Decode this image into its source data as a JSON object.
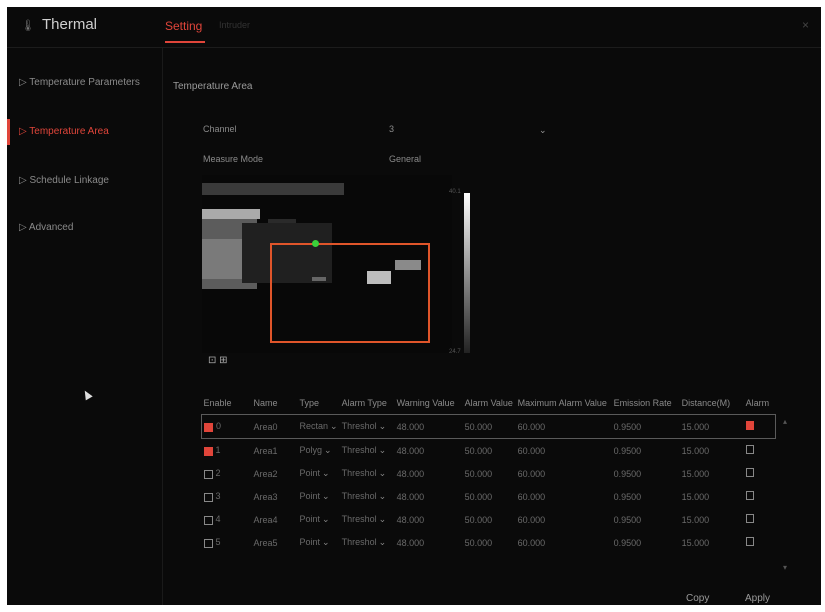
{
  "app": {
    "title": "Thermal",
    "close_icon": "×"
  },
  "tabs": {
    "setting": "Setting",
    "second": "Intruder"
  },
  "sidebar": {
    "items": [
      {
        "label": "▷ Temperature Parameters"
      },
      {
        "label": "▷ Temperature Area"
      },
      {
        "label": "▷ Schedule Linkage"
      },
      {
        "label": "▷ Advanced"
      }
    ]
  },
  "section": {
    "title": "Temperature Area"
  },
  "form": {
    "channel_label": "Channel",
    "channel_value": "3",
    "measure_mode_label": "Measure Mode",
    "measure_mode_value": "General"
  },
  "preview": {
    "icons": "⊡ ⊞",
    "scale_top": "40.1",
    "scale_bottom": "24.7"
  },
  "table": {
    "headers": [
      "Enable",
      "Name",
      "Type",
      "Alarm Type",
      "Warning Value",
      "Alarm Value",
      "Maximum Alarm Value",
      "Emission Rate",
      "Distance(M)",
      "Alarm"
    ],
    "rows": [
      {
        "id": "0",
        "name": "Area0",
        "type": "Rectan",
        "alarm_type": "Threshol",
        "warning": "48.000",
        "alarm": "50.000",
        "max": "60.000",
        "emission": "0.9500",
        "distance": "15.000"
      },
      {
        "id": "1",
        "name": "Area1",
        "type": "Polyg",
        "alarm_type": "Threshol",
        "warning": "48.000",
        "alarm": "50.000",
        "max": "60.000",
        "emission": "0.9500",
        "distance": "15.000"
      },
      {
        "id": "2",
        "name": "Area2",
        "type": "Point",
        "alarm_type": "Threshol",
        "warning": "48.000",
        "alarm": "50.000",
        "max": "60.000",
        "emission": "0.9500",
        "distance": "15.000"
      },
      {
        "id": "3",
        "name": "Area3",
        "type": "Point",
        "alarm_type": "Threshol",
        "warning": "48.000",
        "alarm": "50.000",
        "max": "60.000",
        "emission": "0.9500",
        "distance": "15.000"
      },
      {
        "id": "4",
        "name": "Area4",
        "type": "Point",
        "alarm_type": "Threshol",
        "warning": "48.000",
        "alarm": "50.000",
        "max": "60.000",
        "emission": "0.9500",
        "distance": "15.000"
      },
      {
        "id": "5",
        "name": "Area5",
        "type": "Point",
        "alarm_type": "Threshol",
        "warning": "48.000",
        "alarm": "50.000",
        "max": "60.000",
        "emission": "0.9500",
        "distance": "15.000"
      }
    ]
  },
  "buttons": {
    "copy": "Copy",
    "apply": "Apply"
  },
  "colors": {
    "accent": "#e0453a",
    "background": "#0a0a0a",
    "area_outline": "#e0552a",
    "marker": "#3ad13a"
  }
}
